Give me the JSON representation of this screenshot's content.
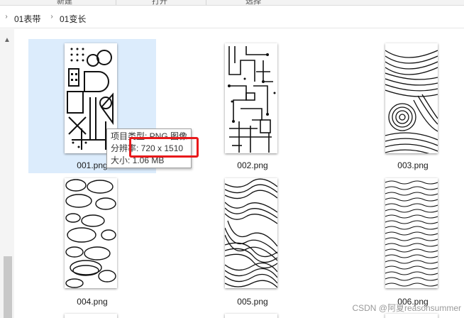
{
  "ribbon": {
    "buttons": [
      "新建",
      "打开",
      "选择"
    ]
  },
  "breadcrumb": {
    "items": [
      "01表带",
      "01变长"
    ]
  },
  "files": [
    {
      "name": "001.png",
      "pattern": "geometric",
      "selected": true
    },
    {
      "name": "002.png",
      "pattern": "circuit",
      "selected": false
    },
    {
      "name": "003.png",
      "pattern": "contour",
      "selected": false
    },
    {
      "name": "004.png",
      "pattern": "ovals",
      "selected": false
    },
    {
      "name": "005.png",
      "pattern": "maze-lines",
      "selected": false
    },
    {
      "name": "006.png",
      "pattern": "waves",
      "selected": false
    }
  ],
  "tooltip": {
    "type_line": "项目类型: PNG 图像",
    "resolution_line": "分辨率: 720 x 1510",
    "size_line": "大小: 1.06 MB"
  },
  "watermark": "CSDN @阿夏reasonsummer",
  "colors": {
    "selection": "#dcecfc",
    "highlight": "#e8191b"
  }
}
